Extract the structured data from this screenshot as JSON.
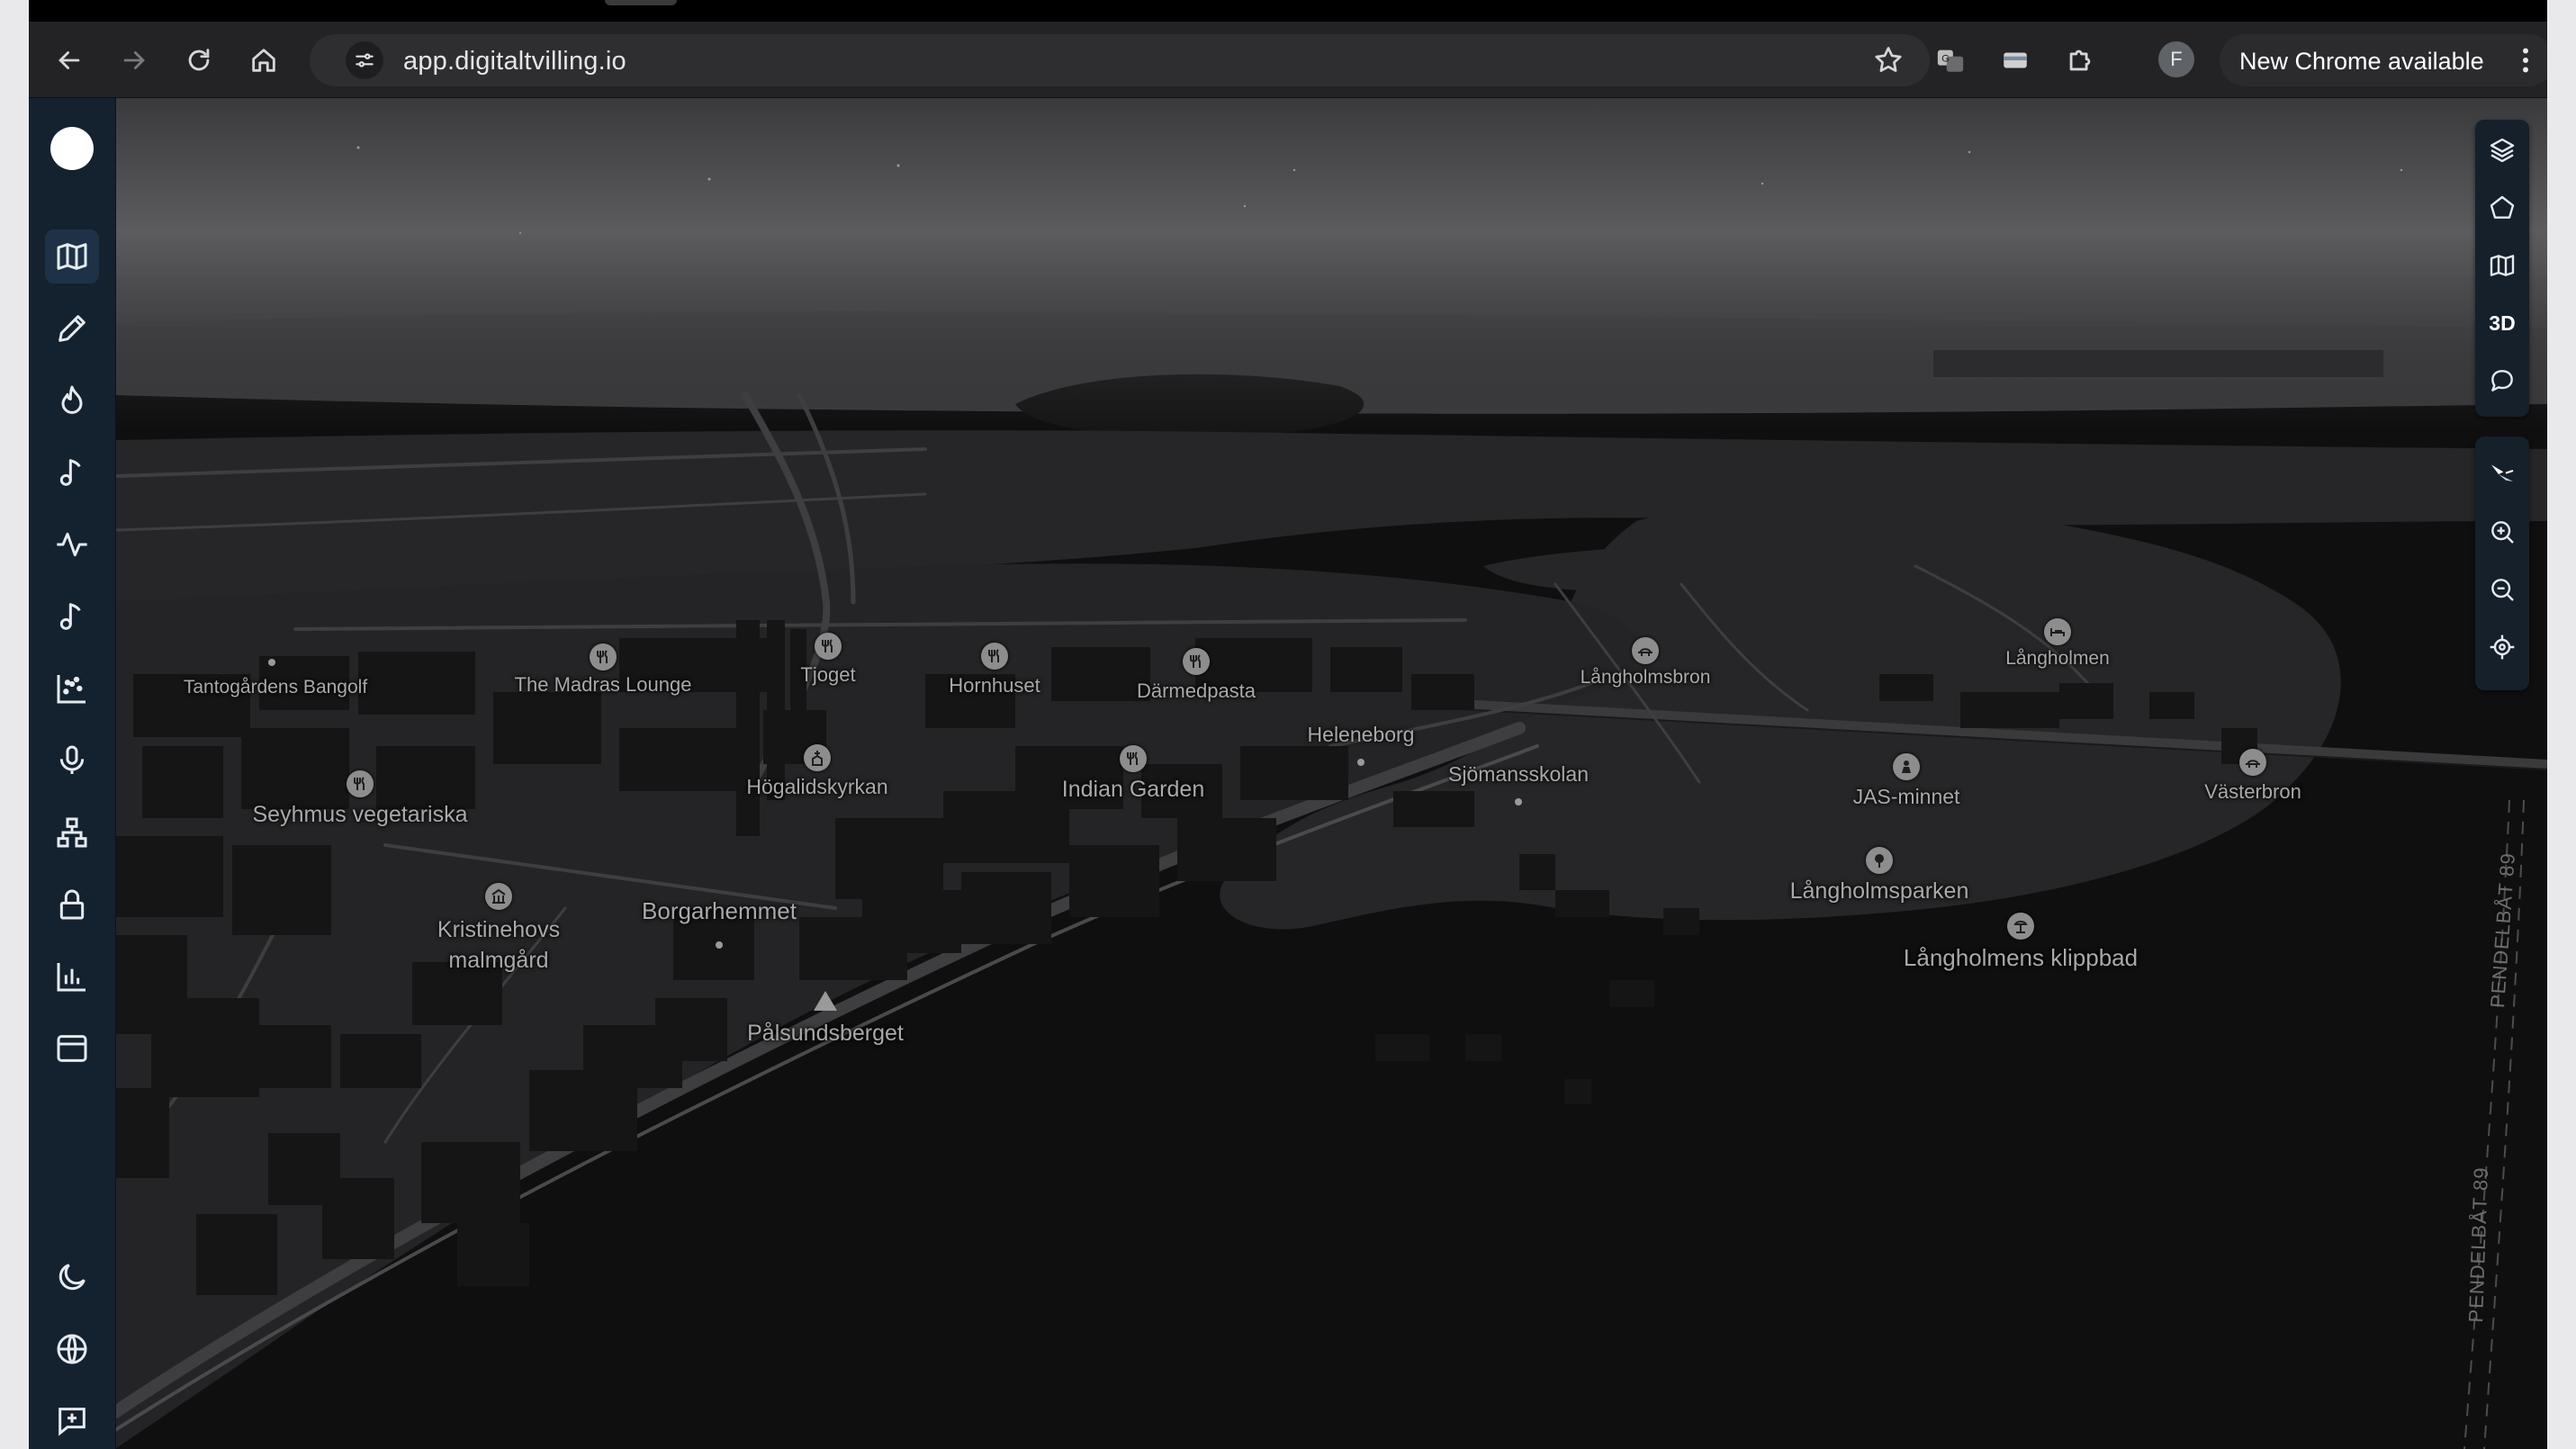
{
  "browser": {
    "url": "app.digitaltvilling.io",
    "profile_initial": "F",
    "update_label": "New Chrome available",
    "nav_icons": [
      "back-arrow-icon",
      "forward-arrow-icon",
      "reload-icon",
      "home-icon"
    ],
    "extension_icons": [
      "translate-icon",
      "card-icon",
      "extensions-puzzle-icon"
    ]
  },
  "sidebar": {
    "top_items": [
      {
        "name": "map-icon",
        "active": true
      },
      {
        "name": "pencil-icon"
      },
      {
        "name": "flame-icon"
      },
      {
        "name": "music-note-icon"
      },
      {
        "name": "activity-pulse-icon"
      },
      {
        "name": "music-note-icon"
      },
      {
        "name": "scatter-chart-icon"
      },
      {
        "name": "microphone-icon"
      },
      {
        "name": "network-hierarchy-icon"
      },
      {
        "name": "lock-icon"
      },
      {
        "name": "bar-chart-icon"
      },
      {
        "name": "window-layout-icon"
      }
    ],
    "bottom_items": [
      {
        "name": "moon-icon"
      },
      {
        "name": "globe-icon"
      },
      {
        "name": "feedback-message-icon"
      }
    ]
  },
  "map_controls": {
    "top_panel": [
      "layers-icon",
      "polygon-icon",
      "map-icon",
      "3D",
      "speech-bubble-icon"
    ],
    "three_d_label": "3D",
    "bottom_panel": [
      "compass-north-icon",
      "zoom-in-icon",
      "zoom-out-icon",
      "locate-icon"
    ]
  },
  "map": {
    "theme": "dark",
    "colors": {
      "water": "#0f0f10",
      "land": "#242426",
      "buildings": "#151515",
      "roads": "#3a3a3a",
      "labels": "#a9a9a9",
      "sky": "#5a5a5c"
    },
    "places": [
      {
        "name": "Tantogårdens Bangolf",
        "icon": "dot"
      },
      {
        "name": "The Madras Lounge",
        "icon": "restaurant-icon"
      },
      {
        "name": "Tjoget",
        "icon": "restaurant-icon"
      },
      {
        "name": "Hornhuset",
        "icon": "restaurant-icon"
      },
      {
        "name": "Därmedpasta",
        "icon": "restaurant-icon"
      },
      {
        "name": "Långholmsbron",
        "icon": "bridge-icon"
      },
      {
        "name": "Långholmen",
        "icon": "bed-icon"
      },
      {
        "name": "Heleneborg",
        "icon": "dot"
      },
      {
        "name": "Sjömansskolan",
        "icon": "dot"
      },
      {
        "name": "Seyhmus vegetariska",
        "icon": "restaurant-icon"
      },
      {
        "name": "Högalidskyrkan",
        "icon": "church-icon"
      },
      {
        "name": "Indian Garden",
        "icon": "restaurant-icon"
      },
      {
        "name": "JAS-minnet",
        "icon": "monument-icon"
      },
      {
        "name": "Västerbron",
        "icon": "bridge-icon"
      },
      {
        "name": "Kristinehovs\nmalmgård",
        "icon": "museum-icon"
      },
      {
        "name": "Borgarhemmet",
        "icon": "dot"
      },
      {
        "name": "Långholmsparken",
        "icon": "tree-icon"
      },
      {
        "name": "Långholmens klippbad",
        "icon": "beach-icon"
      },
      {
        "name": "Pålsundsberget",
        "icon": "mountain-icon"
      }
    ],
    "ferry_labels": [
      "PENDELBÅT 89",
      "PENDELBÅT 89"
    ]
  }
}
